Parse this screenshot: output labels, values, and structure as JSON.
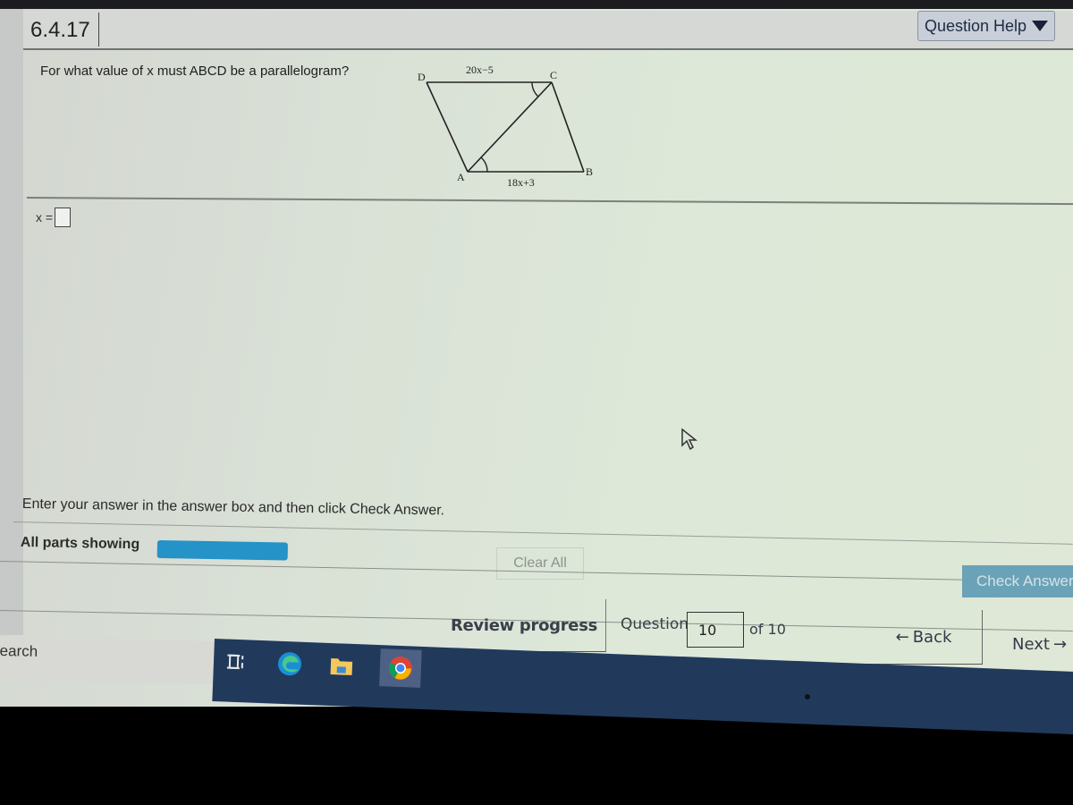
{
  "header": {
    "question_id": "6.4.17",
    "help_button": "Question Help"
  },
  "question": {
    "prompt": "For what value of x must ABCD be a parallelogram?",
    "figure": {
      "vertex_labels": {
        "A": "A",
        "B": "B",
        "C": "C",
        "D": "D"
      },
      "top_side_label": "20x−5",
      "bottom_side_label": "18x+3"
    }
  },
  "answer": {
    "label": "x =",
    "value": ""
  },
  "footer": {
    "instructions": "Enter your answer in the answer box and then click Check Answer.",
    "parts_label": "All parts showing",
    "parts_progress": 1.0,
    "clear_all": "Clear All",
    "check_answer": "Check Answer"
  },
  "navigation": {
    "review_progress": "Review progress",
    "question_label": "Question",
    "question_current": "10",
    "question_of": "of 10",
    "back": "Back",
    "next": "Next"
  },
  "taskbar": {
    "search_text": "earch",
    "icons": [
      "task-view-icon",
      "edge-icon",
      "file-explorer-icon",
      "chrome-icon"
    ]
  },
  "colors": {
    "progress_bar": "#2592c8",
    "check_button": "#6aa3b8",
    "taskbar": "#213a5c"
  }
}
